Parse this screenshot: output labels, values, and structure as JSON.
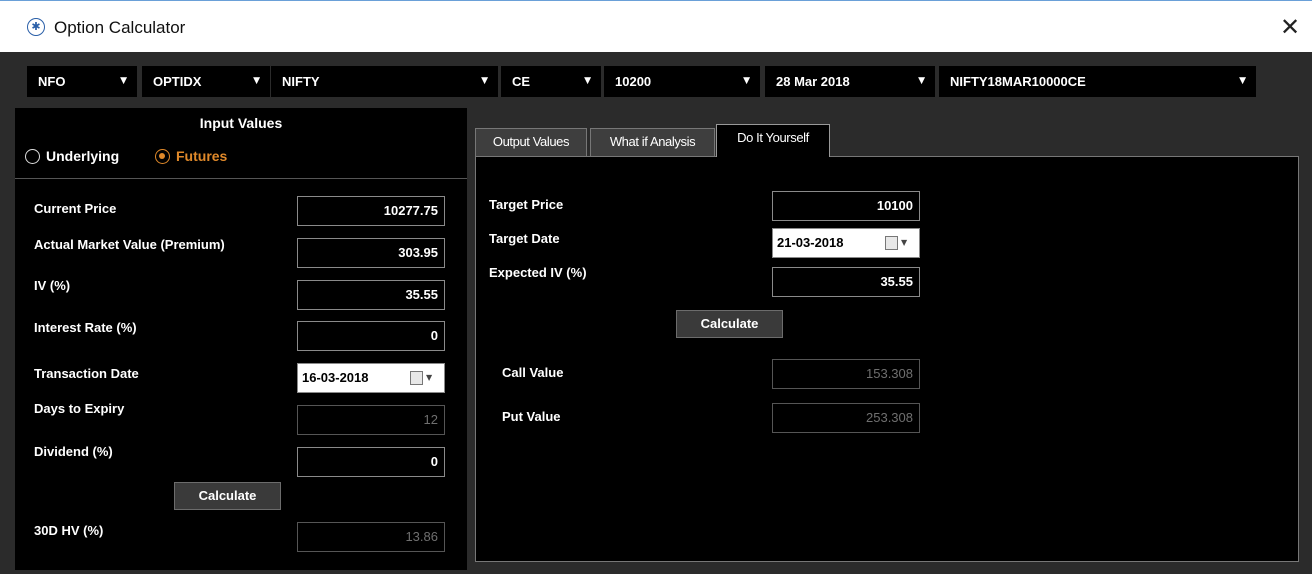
{
  "window": {
    "title": "Option Calculator",
    "icon": "app-logo-icon",
    "close_icon": "close-icon"
  },
  "selectors": {
    "exchange": "NFO",
    "instrument": "OPTIDX",
    "symbol": "NIFTY",
    "option_type": "CE",
    "strike": "10200",
    "expiry": "28 Mar 2018",
    "contract": "NIFTY18MAR10000CE"
  },
  "input_values": {
    "title": "Input Values",
    "radio_underlying": "Underlying",
    "radio_futures": "Futures",
    "selected": "Futures",
    "current_price_label": "Current Price",
    "current_price": "10277.75",
    "actual_market_value_label": "Actual Market Value (Premium)",
    "actual_market_value": "303.95",
    "iv_label": "IV (%)",
    "iv": "35.55",
    "interest_rate_label": "Interest Rate (%)",
    "interest_rate": "0",
    "transaction_date_label": "Transaction Date",
    "transaction_date": "16-03-2018",
    "days_to_expiry_label": "Days to Expiry",
    "days_to_expiry": "12",
    "dividend_label": "Dividend (%)",
    "dividend": "0",
    "calculate_label": "Calculate",
    "hv_label": "30D HV (%)",
    "hv": "13.86"
  },
  "tabs": [
    {
      "label": "Output Values",
      "active": false
    },
    {
      "label": "What if Analysis",
      "active": false
    },
    {
      "label": "Do It Yourself",
      "active": true
    }
  ],
  "diy": {
    "target_price_label": "Target Price",
    "target_price": "10100",
    "target_date_label": "Target Date",
    "target_date": "21-03-2018",
    "expected_iv_label": "Expected IV (%)",
    "expected_iv": "35.55",
    "calculate_label": "Calculate",
    "call_value_label": "Call Value",
    "call_value": "153.308",
    "put_value_label": "Put Value",
    "put_value": "253.308"
  },
  "colors": {
    "accent": "#e0892a",
    "background": "#2b2b2b",
    "panel": "#000000"
  }
}
